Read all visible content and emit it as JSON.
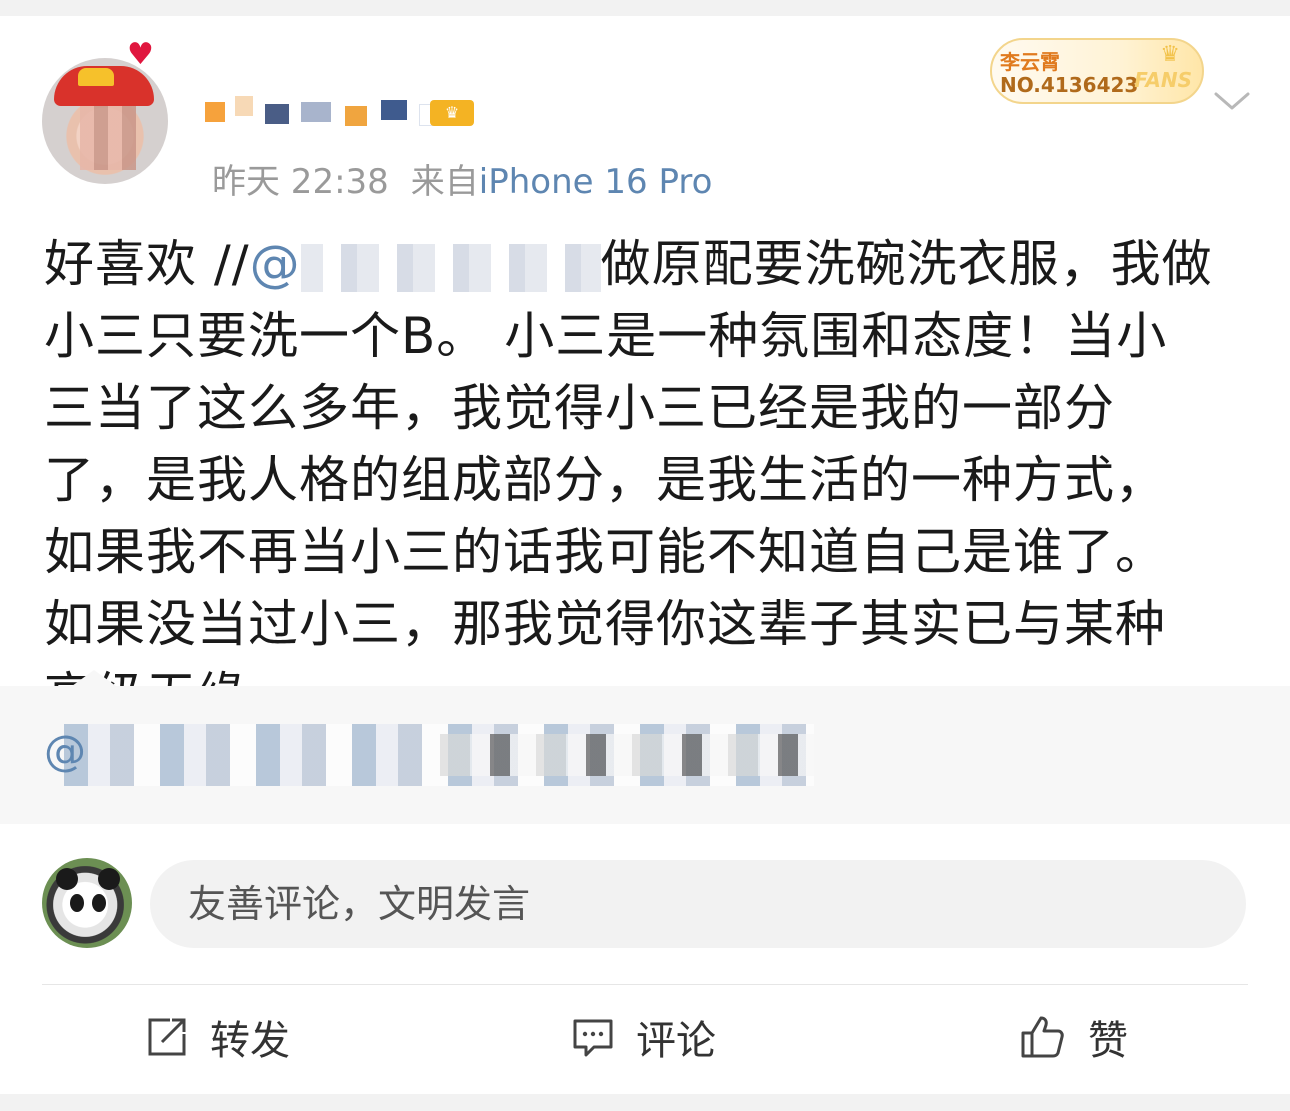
{
  "post": {
    "time": "昨天 22:38",
    "source_prefix": "来自",
    "device": "iPhone 16 Pro",
    "fans_badge": {
      "name": "李云霄",
      "number": "NO.4136423",
      "label": "FANS"
    },
    "text_start": "好喜欢 //",
    "mention_at": "@",
    "text_after_mention": "做原配要洗碗洗衣服，我做小三只要洗一个B。 小三是一种氛围和态度！当小三当了这么多年，我觉得小三已经是我的一部分了，是我人格的组成部分，是我生活的一种方式，如果我不再当小三的话我可能不知道自己是谁了。如果没当过小三，那我觉得你这辈子其实已与某种高级无缘。"
  },
  "retweet": {
    "at": "@"
  },
  "comment_box": {
    "placeholder": "友善评论，文明发言"
  },
  "actions": {
    "repost": "转发",
    "comment": "评论",
    "like": "赞"
  },
  "colors": {
    "link": "#5e86b1",
    "meta": "#9a9a9a",
    "text": "#1a1a1a",
    "badge": "#e07a1e"
  },
  "icons": [
    "heart-icon",
    "crown-icon",
    "chevron-down-icon",
    "repost-icon",
    "comment-icon",
    "like-icon"
  ]
}
